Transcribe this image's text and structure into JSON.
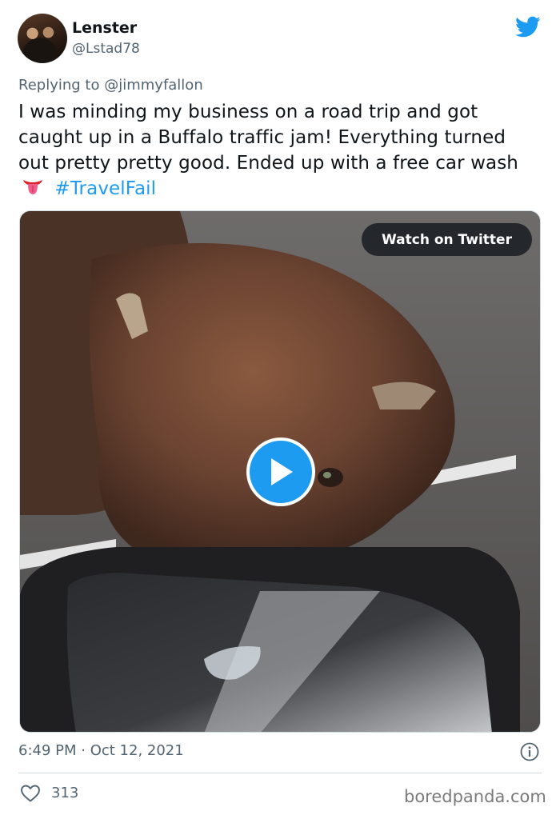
{
  "author": {
    "display_name": "Lenster",
    "handle": "@Lstad78"
  },
  "reply": {
    "prefix": "Replying to",
    "mention": "@jimmyfallon"
  },
  "tweet": {
    "text": "I was minding my business on a road trip and got caught up in a Buffalo traffic jam! Everything turned out pretty pretty good. Ended up with a free car wash",
    "emoji_icon": "tongue-emoji-icon",
    "hashtag": "#TravelFail"
  },
  "media": {
    "watch_label": "Watch on Twitter",
    "play_icon": "play-icon"
  },
  "meta": {
    "timestamp": "6:49 PM · Oct 12, 2021",
    "like_count": "313"
  },
  "watermark": "boredpanda.com",
  "colors": {
    "accent": "#1d9bf0",
    "text": "#0f1419",
    "secondary": "#536471",
    "border": "#cfd9de"
  }
}
